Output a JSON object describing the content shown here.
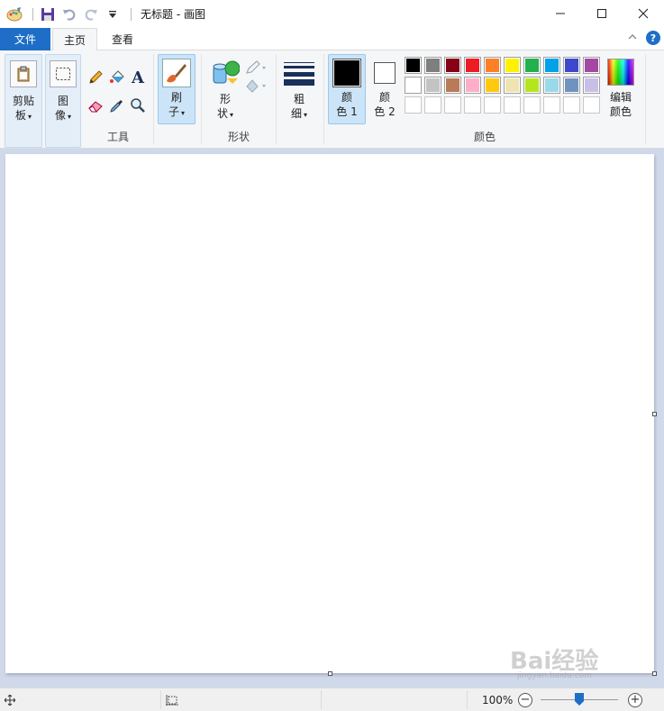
{
  "window": {
    "title": "无标题 - 画图"
  },
  "tabs": [
    {
      "label": "文件"
    },
    {
      "label": "主页"
    },
    {
      "label": "查看"
    }
  ],
  "ribbon": {
    "clipboard": {
      "label_line1": "剪贴",
      "label_line2": "板"
    },
    "image": {
      "label_line1": "图",
      "label_line2": "像"
    },
    "tools": {
      "group_label": "工具"
    },
    "brushes": {
      "label_line1": "刷",
      "label_line2": "子"
    },
    "shapes": {
      "label_line1": "形",
      "label_line2": "状",
      "group_label": "形状"
    },
    "size": {
      "label_line1": "粗",
      "label_line2": "细"
    },
    "color1": {
      "label_line1": "颜",
      "label_line2": "色 1",
      "value": "#000000"
    },
    "color2": {
      "label_line1": "颜",
      "label_line2": "色 2",
      "value": "#ffffff"
    },
    "colors": {
      "group_label": "颜色"
    },
    "edit_colors": {
      "label_line1": "编辑",
      "label_line2": "颜色"
    }
  },
  "palette": {
    "row1": [
      "#000000",
      "#7f7f7f",
      "#880015",
      "#ed1c24",
      "#ff7f27",
      "#fff200",
      "#22b14c",
      "#00a2e8",
      "#3f48cc",
      "#a349a4"
    ],
    "row2": [
      "#ffffff",
      "#c3c3c3",
      "#b97a57",
      "#ffaec9",
      "#ffc90e",
      "#efe4b0",
      "#b5e61d",
      "#99d9ea",
      "#7092be",
      "#c8bfe7"
    ],
    "row3": [
      "",
      "",
      "",
      "",
      "",
      "",
      "",
      "",
      "",
      ""
    ]
  },
  "status": {
    "zoom": "100%",
    "zoom_level_percent": 100
  },
  "watermark": {
    "text": "Bai经验",
    "sub": "jingyan.baidu.com"
  }
}
